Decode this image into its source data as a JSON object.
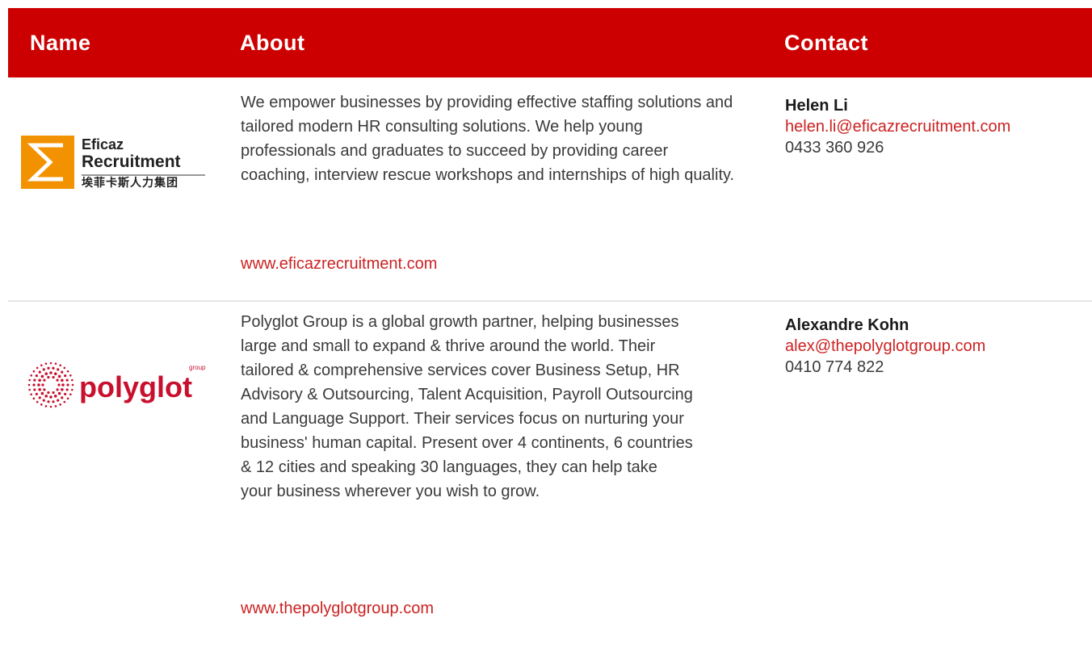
{
  "header": {
    "name": "Name",
    "about": "About",
    "contact": "Contact"
  },
  "rows": [
    {
      "logo": {
        "line1": "Eficaz",
        "line2": "Recruitment",
        "line3": "埃菲卡斯人力集团"
      },
      "about": "We empower businesses by providing effective staffing solutions and tailored modern HR consulting solutions. We help young professionals and graduates to succeed by providing career coaching, interview rescue workshops and internships of high quality.",
      "website": "www.eficazrecruitment.com",
      "contact": {
        "name": "Helen Li",
        "email": "helen.li@eficazrecruitment.com",
        "phone": "0433 360 926"
      }
    },
    {
      "logo": {
        "word": "polyglot",
        "small": "group"
      },
      "about": "Polyglot Group is a global growth partner, helping businesses large and small to expand & thrive around the world. Their tailored & comprehensive services cover Business Setup, HR Advisory & Outsourcing, Talent Acquisition, Payroll Outsourcing and Language Support. Their services focus on nurturing your business' human capital. Present over 4 continents, 6 countries & 12 cities and speaking 30 languages, they can help take your business wherever you wish to grow.",
      "website": "www.thepolyglotgroup.com",
      "contact": {
        "name": "Alexandre Kohn",
        "email": "alex@thepolyglotgroup.com",
        "phone": "0410 774 822"
      }
    }
  ],
  "colors": {
    "accent": "#cc0000",
    "link": "#cc2222",
    "eficaz_orange": "#f39200"
  }
}
